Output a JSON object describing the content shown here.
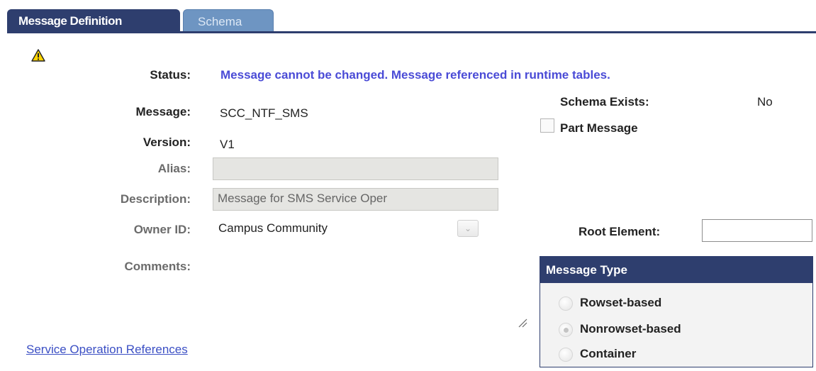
{
  "tabs": [
    {
      "label": "Message Definition",
      "active": true
    },
    {
      "label": "Schema",
      "active": false
    }
  ],
  "status": {
    "label": "Status:",
    "value": "Message cannot be changed.  Message referenced in runtime tables."
  },
  "message": {
    "label": "Message:",
    "value": "SCC_NTF_SMS"
  },
  "version": {
    "label": "Version:",
    "value": "V1"
  },
  "alias": {
    "label": "Alias:",
    "value": ""
  },
  "description": {
    "label": "Description:",
    "value": "Message for SMS Service Oper"
  },
  "owner_id": {
    "label": "Owner ID:",
    "value": "Campus Community"
  },
  "comments": {
    "label": "Comments:"
  },
  "schema_exists": {
    "label": "Schema Exists:",
    "value": "No"
  },
  "part_message": {
    "label": "Part Message",
    "checked": false
  },
  "root_element": {
    "label": "Root Element:",
    "value": ""
  },
  "message_type": {
    "title": "Message Type",
    "options": [
      {
        "label": "Rowset-based",
        "selected": false
      },
      {
        "label": "Nonrowset-based",
        "selected": true
      },
      {
        "label": "Container",
        "selected": false
      }
    ]
  },
  "links": {
    "service_operation_references": "Service Operation References"
  },
  "icons": {
    "warning": "warning-icon",
    "resize": "resize-handle-icon",
    "dropdown": "chevron-down-icon"
  },
  "colors": {
    "tab_active": "#2e3e6e",
    "tab_inactive": "#6e95c2",
    "status_text": "#4a4bd6",
    "link": "#3b4fc4"
  }
}
